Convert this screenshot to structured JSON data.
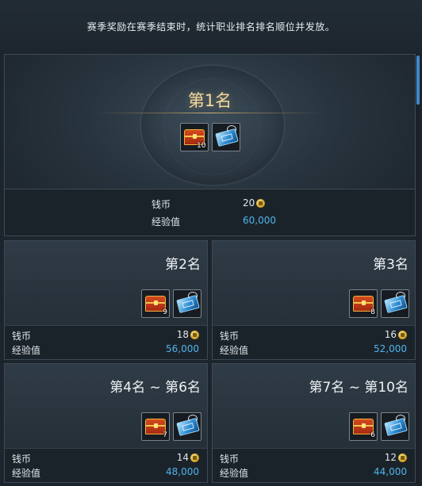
{
  "notice": "赛季奖励在赛季结束时，统计职业排名排名顺位并发放。",
  "tiers": [
    {
      "rank": "第1名",
      "chest_count": "10",
      "coin_label": "钱币",
      "coin_value": "20",
      "exp_label": "经验值",
      "exp_value": "60,000"
    },
    {
      "rank": "第2名",
      "chest_count": "9",
      "coin_label": "钱币",
      "coin_value": "18",
      "exp_label": "经验值",
      "exp_value": "56,000"
    },
    {
      "rank": "第3名",
      "chest_count": "8",
      "coin_label": "钱币",
      "coin_value": "16",
      "exp_label": "经验值",
      "exp_value": "52,000"
    },
    {
      "rank": "第4名 ~ 第6名",
      "chest_count": "7",
      "coin_label": "钱币",
      "coin_value": "14",
      "exp_label": "经验值",
      "exp_value": "48,000"
    },
    {
      "rank": "第7名 ~ 第10名",
      "chest_count": "6",
      "coin_label": "钱币",
      "coin_value": "12",
      "exp_label": "经验值",
      "exp_value": "44,000"
    }
  ],
  "icons": {
    "chest": "treasure-chest-icon",
    "ticket": "blue-ticket-icon",
    "coin": "gold-coin-icon"
  },
  "colors": {
    "rank1_title": "#f2d79a",
    "exp_value": "#4fb4ec",
    "scrollbar": "#3d88c6"
  }
}
